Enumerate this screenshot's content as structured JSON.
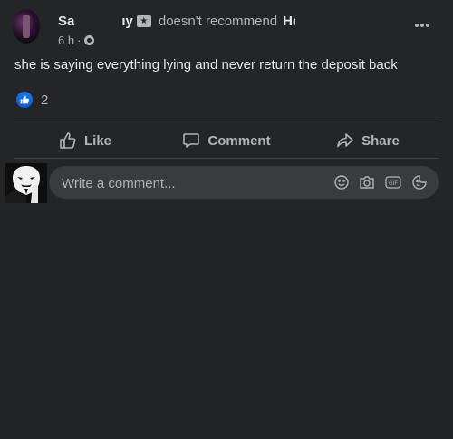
{
  "post": {
    "author_first": "Sa",
    "author_last": "ıy",
    "recommend_text": "doesn't recommend",
    "page_name": "He",
    "time": "6 h",
    "separator": "·",
    "body": "she is saying everything lying and never return the deposit back",
    "reactions": {
      "count": "2",
      "type": "like-icon"
    },
    "actions": {
      "like": "Like",
      "comment": "Comment",
      "share": "Share"
    }
  },
  "comment": {
    "placeholder": "Write a comment...",
    "tools": [
      "emoji-icon",
      "camera-icon",
      "gif-icon",
      "sticker-icon"
    ]
  },
  "colors": {
    "background": "#242526",
    "text": "#e4e6eb",
    "secondary_text": "#b0b3b8",
    "accent": "#1877f2",
    "input_bg": "#3a3b3c"
  }
}
